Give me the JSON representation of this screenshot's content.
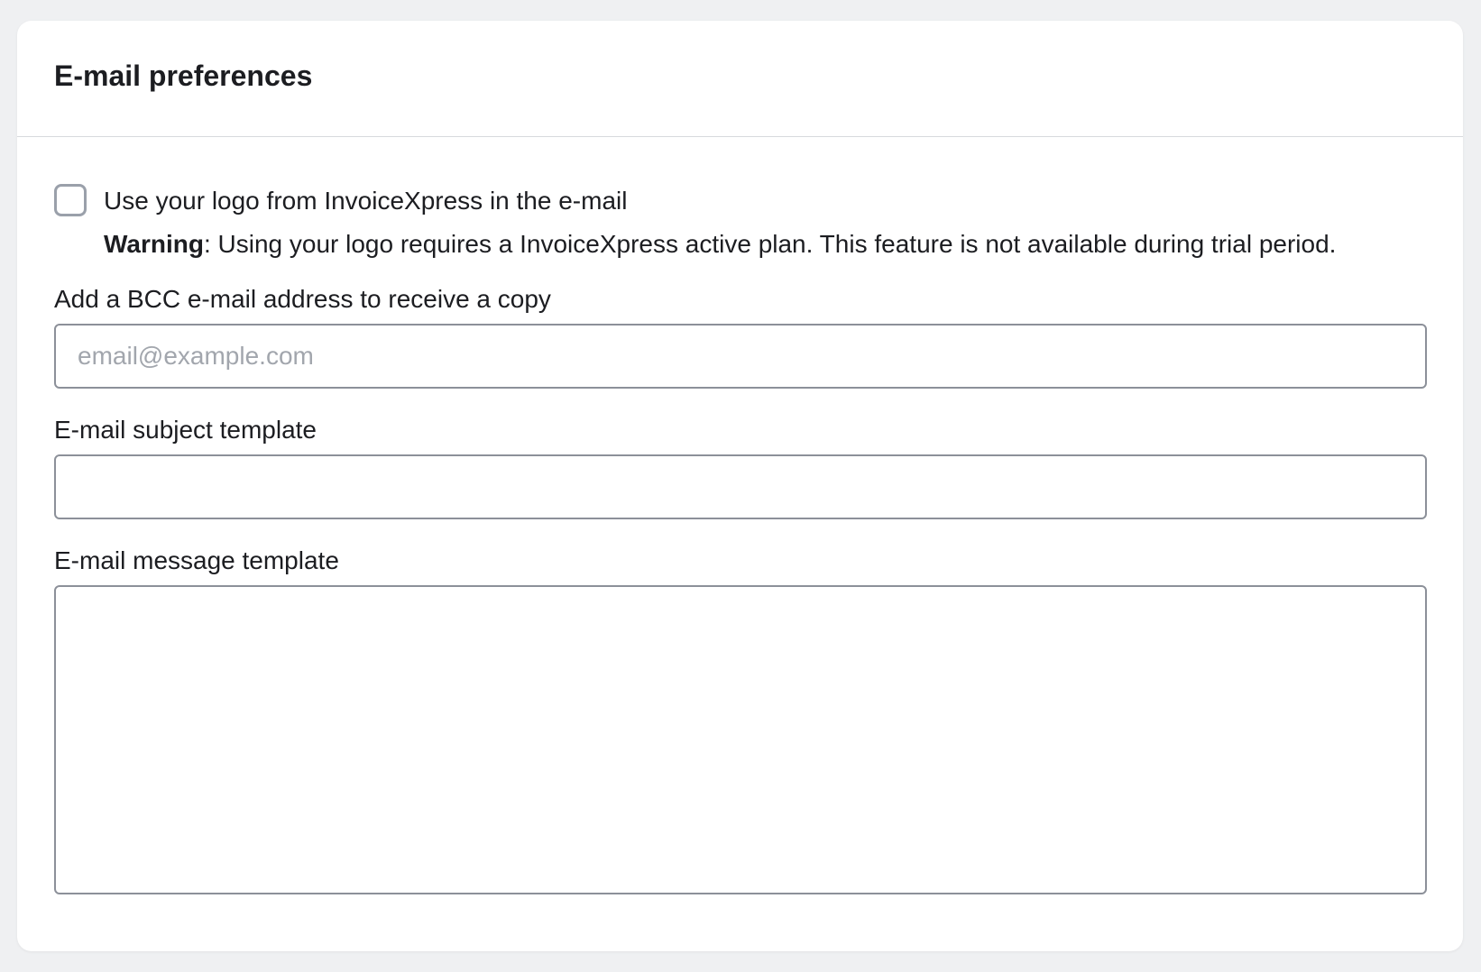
{
  "card": {
    "title": "E-mail preferences"
  },
  "logo_option": {
    "checked": false,
    "label": "Use your logo from InvoiceXpress in the e-mail",
    "warning_strong": "Warning",
    "warning_text": ": Using your logo requires a InvoiceXpress active plan. This feature is not available during trial period."
  },
  "bcc": {
    "label": "Add a BCC e-mail address to receive a copy",
    "placeholder": "email@example.com",
    "value": ""
  },
  "subject": {
    "label": "E-mail subject template",
    "value": ""
  },
  "message": {
    "label": "E-mail message template",
    "value": ""
  }
}
